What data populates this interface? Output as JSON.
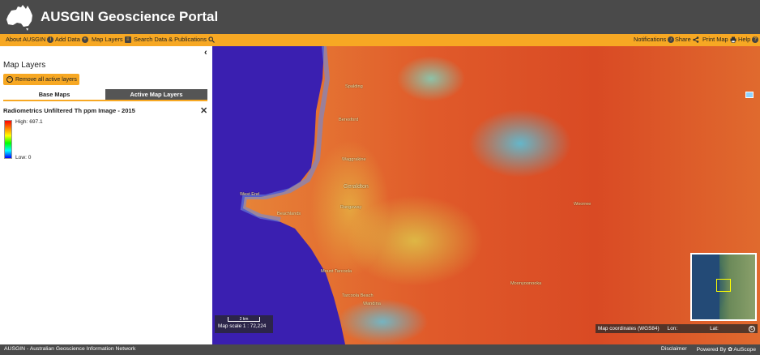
{
  "header": {
    "title": "AUSGIN Geoscience Portal"
  },
  "menu": {
    "left": [
      {
        "label": "About AUSGIN",
        "icon": "info-icon"
      },
      {
        "label": "Add Data",
        "icon": "plus-icon"
      },
      {
        "label": "Map Layers",
        "icon": "layers-icon"
      },
      {
        "label": "Search Data & Publications",
        "icon": "search-icon"
      }
    ],
    "right": [
      {
        "label": "Notifications",
        "icon": "bell-icon"
      },
      {
        "label": "Share",
        "icon": "share-icon"
      },
      {
        "label": "Print Map",
        "icon": "print-icon"
      },
      {
        "label": "Help",
        "icon": "help-icon"
      }
    ]
  },
  "panel": {
    "title": "Map Layers",
    "remove_button": "Remove all active layers",
    "tabs": {
      "base": "Base Maps",
      "active": "Active Map Layers"
    },
    "layer": {
      "name": "Radiometrics Unfiltered Th ppm Image - 2015",
      "legend_high": "High: 697.1",
      "legend_low": "Low: 0"
    }
  },
  "map": {
    "labels": [
      "Spalding",
      "Beresford",
      "Waggrakine",
      "Woorree",
      "Geraldton",
      "Rangeway",
      "West End",
      "Beachlands",
      "Moonyoonooka",
      "Mount Tarcoola",
      "Tarcoola Beach",
      "Wandina"
    ],
    "scale_bar": "2 km",
    "scale_text": "Map scale 1 : 72,224",
    "coords": {
      "label": "Map coordinates (WGS84)",
      "lon": "Lon:",
      "lat": "Lat:"
    }
  },
  "footer": {
    "left": "AUSGIN - Australian Geoscience Information Network",
    "disclaimer": "Disclaimer",
    "powered": "Powered By",
    "auscope": "AuScope"
  },
  "colors": {
    "header_bg": "#4a4a4a",
    "accent": "#f7a823"
  }
}
